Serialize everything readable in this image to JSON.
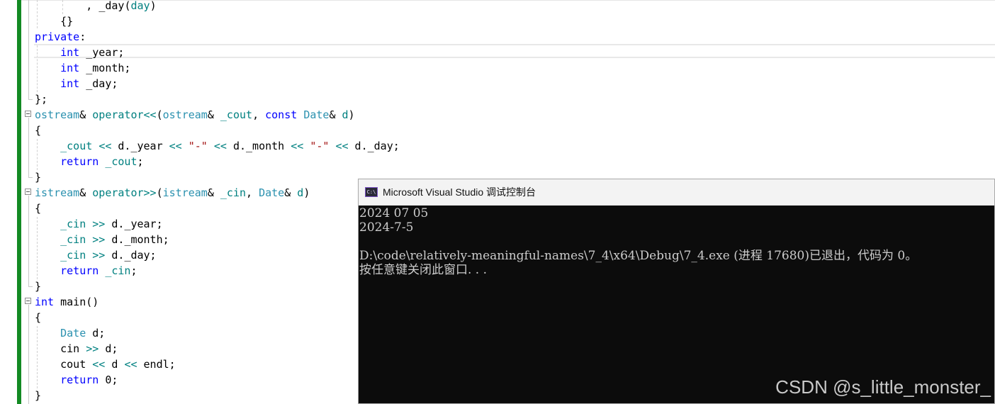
{
  "editor": {
    "lines": [
      {
        "segments": [
          {
            "t": "        , ",
            "c": "pl"
          },
          {
            "t": "_day",
            "c": "pl"
          },
          {
            "t": "(",
            "c": "pl"
          },
          {
            "t": "day",
            "c": "op"
          },
          {
            "t": ")",
            "c": "pl"
          }
        ]
      },
      {
        "segments": [
          {
            "t": "    {}",
            "c": "pl"
          }
        ]
      },
      {
        "segments": [
          {
            "t": "private",
            "c": "kw"
          },
          {
            "t": ":",
            "c": "pl"
          }
        ]
      },
      {
        "segments": [
          {
            "t": "    ",
            "c": "pl"
          },
          {
            "t": "int",
            "c": "kw"
          },
          {
            "t": " _year;",
            "c": "pl"
          }
        ]
      },
      {
        "segments": [
          {
            "t": "    ",
            "c": "pl"
          },
          {
            "t": "int",
            "c": "kw"
          },
          {
            "t": " _month;",
            "c": "pl"
          }
        ]
      },
      {
        "segments": [
          {
            "t": "    ",
            "c": "pl"
          },
          {
            "t": "int",
            "c": "kw"
          },
          {
            "t": " _day;",
            "c": "pl"
          }
        ]
      },
      {
        "segments": [
          {
            "t": "};",
            "c": "pl"
          }
        ]
      },
      {
        "segments": [
          {
            "t": "ostream",
            "c": "ty"
          },
          {
            "t": "& ",
            "c": "pl"
          },
          {
            "t": "operator<<",
            "c": "op"
          },
          {
            "t": "(",
            "c": "pl"
          },
          {
            "t": "ostream",
            "c": "ty"
          },
          {
            "t": "& ",
            "c": "pl"
          },
          {
            "t": "_cout",
            "c": "op"
          },
          {
            "t": ", ",
            "c": "pl"
          },
          {
            "t": "const",
            "c": "kw"
          },
          {
            "t": " ",
            "c": "pl"
          },
          {
            "t": "Date",
            "c": "ty"
          },
          {
            "t": "& ",
            "c": "pl"
          },
          {
            "t": "d",
            "c": "op"
          },
          {
            "t": ")",
            "c": "pl"
          }
        ]
      },
      {
        "segments": [
          {
            "t": "{",
            "c": "pl"
          }
        ]
      },
      {
        "segments": [
          {
            "t": "    ",
            "c": "pl"
          },
          {
            "t": "_cout",
            "c": "op"
          },
          {
            "t": " ",
            "c": "pl"
          },
          {
            "t": "<<",
            "c": "op"
          },
          {
            "t": " d.",
            "c": "pl"
          },
          {
            "t": "_year",
            "c": "pl"
          },
          {
            "t": " ",
            "c": "pl"
          },
          {
            "t": "<<",
            "c": "op"
          },
          {
            "t": " ",
            "c": "pl"
          },
          {
            "t": "\"-\"",
            "c": "str"
          },
          {
            "t": " ",
            "c": "pl"
          },
          {
            "t": "<<",
            "c": "op"
          },
          {
            "t": " d.",
            "c": "pl"
          },
          {
            "t": "_month",
            "c": "pl"
          },
          {
            "t": " ",
            "c": "pl"
          },
          {
            "t": "<<",
            "c": "op"
          },
          {
            "t": " ",
            "c": "pl"
          },
          {
            "t": "\"-\"",
            "c": "str"
          },
          {
            "t": " ",
            "c": "pl"
          },
          {
            "t": "<<",
            "c": "op"
          },
          {
            "t": " d.",
            "c": "pl"
          },
          {
            "t": "_day;",
            "c": "pl"
          }
        ]
      },
      {
        "segments": [
          {
            "t": "    ",
            "c": "pl"
          },
          {
            "t": "return",
            "c": "kw"
          },
          {
            "t": " ",
            "c": "pl"
          },
          {
            "t": "_cout",
            "c": "op"
          },
          {
            "t": ";",
            "c": "pl"
          }
        ]
      },
      {
        "segments": [
          {
            "t": "}",
            "c": "pl"
          }
        ]
      },
      {
        "segments": [
          {
            "t": "istream",
            "c": "ty"
          },
          {
            "t": "& ",
            "c": "pl"
          },
          {
            "t": "operator>>",
            "c": "op"
          },
          {
            "t": "(",
            "c": "pl"
          },
          {
            "t": "istream",
            "c": "ty"
          },
          {
            "t": "& ",
            "c": "pl"
          },
          {
            "t": "_cin",
            "c": "op"
          },
          {
            "t": ", ",
            "c": "pl"
          },
          {
            "t": "Date",
            "c": "ty"
          },
          {
            "t": "& ",
            "c": "pl"
          },
          {
            "t": "d",
            "c": "op"
          },
          {
            "t": ")",
            "c": "pl"
          }
        ]
      },
      {
        "segments": [
          {
            "t": "{",
            "c": "pl"
          }
        ]
      },
      {
        "segments": [
          {
            "t": "    ",
            "c": "pl"
          },
          {
            "t": "_cin",
            "c": "op"
          },
          {
            "t": " ",
            "c": "pl"
          },
          {
            "t": ">>",
            "c": "op"
          },
          {
            "t": " d.",
            "c": "pl"
          },
          {
            "t": "_year;",
            "c": "pl"
          }
        ]
      },
      {
        "segments": [
          {
            "t": "    ",
            "c": "pl"
          },
          {
            "t": "_cin",
            "c": "op"
          },
          {
            "t": " ",
            "c": "pl"
          },
          {
            "t": ">>",
            "c": "op"
          },
          {
            "t": " d.",
            "c": "pl"
          },
          {
            "t": "_month;",
            "c": "pl"
          }
        ]
      },
      {
        "segments": [
          {
            "t": "    ",
            "c": "pl"
          },
          {
            "t": "_cin",
            "c": "op"
          },
          {
            "t": " ",
            "c": "pl"
          },
          {
            "t": ">>",
            "c": "op"
          },
          {
            "t": " d.",
            "c": "pl"
          },
          {
            "t": "_day;",
            "c": "pl"
          }
        ]
      },
      {
        "segments": [
          {
            "t": "    ",
            "c": "pl"
          },
          {
            "t": "return",
            "c": "kw"
          },
          {
            "t": " ",
            "c": "pl"
          },
          {
            "t": "_cin",
            "c": "op"
          },
          {
            "t": ";",
            "c": "pl"
          }
        ]
      },
      {
        "segments": [
          {
            "t": "}",
            "c": "pl"
          }
        ]
      },
      {
        "segments": [
          {
            "t": "int",
            "c": "kw"
          },
          {
            "t": " main()",
            "c": "pl"
          }
        ]
      },
      {
        "segments": [
          {
            "t": "{",
            "c": "pl"
          }
        ]
      },
      {
        "segments": [
          {
            "t": "    ",
            "c": "pl"
          },
          {
            "t": "Date",
            "c": "ty"
          },
          {
            "t": " d;",
            "c": "pl"
          }
        ]
      },
      {
        "segments": [
          {
            "t": "    cin ",
            "c": "pl"
          },
          {
            "t": ">>",
            "c": "op"
          },
          {
            "t": " d;",
            "c": "pl"
          }
        ]
      },
      {
        "segments": [
          {
            "t": "    cout ",
            "c": "pl"
          },
          {
            "t": "<<",
            "c": "op"
          },
          {
            "t": " d ",
            "c": "pl"
          },
          {
            "t": "<<",
            "c": "op"
          },
          {
            "t": " endl;",
            "c": "pl"
          }
        ]
      },
      {
        "segments": [
          {
            "t": "    ",
            "c": "pl"
          },
          {
            "t": "return",
            "c": "kw"
          },
          {
            "t": " 0;",
            "c": "pl"
          }
        ]
      },
      {
        "segments": [
          {
            "t": "}",
            "c": "pl"
          }
        ]
      }
    ]
  },
  "console": {
    "icon_text": "C:\\",
    "title": "Microsoft Visual Studio 调试控制台",
    "lines": [
      "2024 07 05",
      "2024-7-5",
      "",
      "D:\\code\\relatively-meaningful-names\\7_4\\x64\\Debug\\7_4.exe (进程 17680)已退出，代码为 0。",
      "按任意键关闭此窗口. . ."
    ]
  },
  "watermark": "CSDN @s_little_monster_"
}
